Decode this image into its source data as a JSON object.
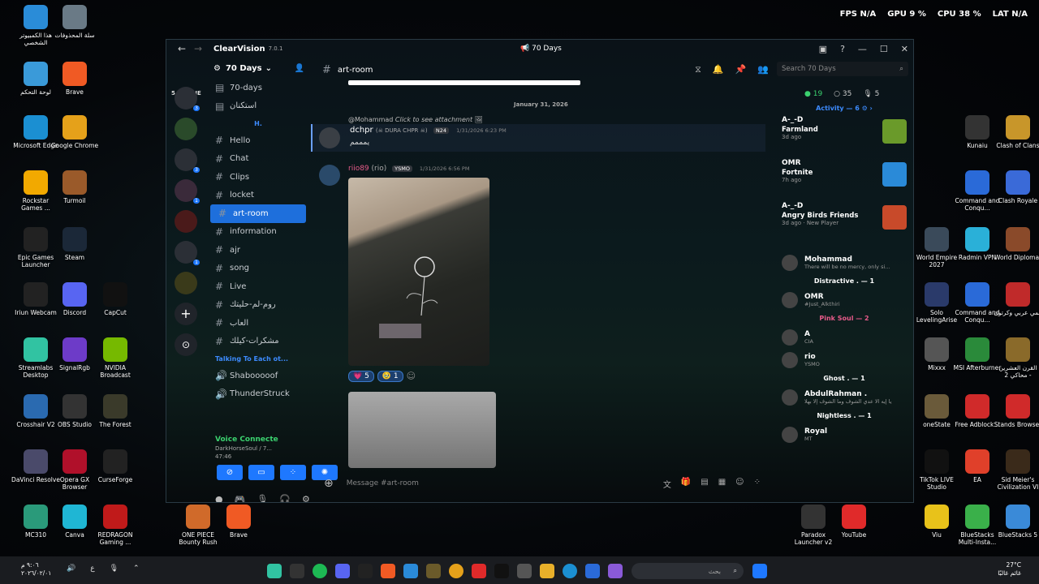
{
  "hud": {
    "fps_label": "FPS",
    "fps": "N/A",
    "gpu_label": "GPU",
    "gpu": "9 %",
    "cpu_label": "CPU",
    "cpu": "38 %",
    "lat_label": "LAT",
    "lat": "N/A"
  },
  "desktop_left": [
    {
      "label": "هذا الكمبيوتر الشخصي",
      "icon": "pc",
      "color": "#2a8cd8"
    },
    {
      "label": "سلة المحذوفات",
      "icon": "recycle",
      "color": "#6a7a86"
    },
    {
      "label": "لوحة التحكم",
      "icon": "panel",
      "color": "#3a9ad9"
    },
    {
      "label": "Brave",
      "icon": "brave",
      "color": "#f05a24"
    },
    {
      "label": "Microsoft Edge",
      "icon": "edge",
      "color": "#1b8fd2"
    },
    {
      "label": "Google Chrome",
      "icon": "chrome",
      "color": "#e5a11a"
    },
    {
      "label": "Rockstar Games ...",
      "icon": "rockstar",
      "color": "#f2a900"
    },
    {
      "label": "Turmoil",
      "icon": "turmoil",
      "color": "#9a5a2a"
    },
    {
      "label": "Epic Games Launcher",
      "icon": "epic",
      "color": "#222"
    },
    {
      "label": "Steam",
      "icon": "steam",
      "color": "#1b2838"
    },
    {
      "label": "Iriun Webcam",
      "icon": "iriun",
      "color": "#222"
    },
    {
      "label": "Discord",
      "icon": "discord",
      "color": "#5865f2"
    },
    {
      "label": "CapCut",
      "icon": "capcut",
      "color": "#111"
    },
    {
      "label": "Streamlabs Desktop",
      "icon": "streamlabs",
      "color": "#31c3a2"
    },
    {
      "label": "SignalRgb",
      "icon": "signalrgb",
      "color": "#6d3bc8"
    },
    {
      "label": "NVIDIA Broadcast",
      "icon": "nvidia",
      "color": "#76b900"
    },
    {
      "label": "Crosshair V2",
      "icon": "crosshair",
      "color": "#2a6ab0"
    },
    {
      "label": "OBS Studio",
      "icon": "obs",
      "color": "#333"
    },
    {
      "label": "The Forest",
      "icon": "forest",
      "color": "#3a3a2a"
    },
    {
      "label": "DaVinci Resolve",
      "icon": "davinci",
      "color": "#4a4a6a"
    },
    {
      "label": "Opera GX Browser",
      "icon": "opera",
      "color": "#b0102a"
    },
    {
      "label": "CurseForge",
      "icon": "curseforge",
      "color": "#222"
    },
    {
      "label": "MC310",
      "icon": "mc310",
      "color": "#2a9a7a"
    },
    {
      "label": "Canva",
      "icon": "canva",
      "color": "#1fb6d4"
    },
    {
      "label": "REDRAGON Gaming ...",
      "icon": "redragon",
      "color": "#c01a1a"
    },
    {
      "label": "ONE PIECE Bounty Rush",
      "icon": "onepiece",
      "color": "#d06a2a"
    },
    {
      "label": "Brave",
      "icon": "brave",
      "color": "#f05a24"
    }
  ],
  "desktop_right": [
    {
      "label": "Kunaiu",
      "icon": "kunai",
      "color": "#333"
    },
    {
      "label": "Clash of Clans",
      "icon": "coc",
      "color": "#c8962a"
    },
    {
      "label": "Command and Conqu...",
      "icon": "cnc",
      "color": "#2a6ad8"
    },
    {
      "label": "Clash Royale",
      "icon": "royale",
      "color": "#3a6ad8"
    },
    {
      "label": "World Empire 2027",
      "icon": "worldempire",
      "color": "#3a4a5a"
    },
    {
      "label": "Radmin VPN",
      "icon": "radmin",
      "color": "#2ab0d8"
    },
    {
      "label": "World Diplomat",
      "icon": "diplomat",
      "color": "#8a4a2a"
    },
    {
      "label": "Solo LevelingArise",
      "icon": "solo",
      "color": "#2a3a6a"
    },
    {
      "label": "Command and Conqu...",
      "icon": "cnc",
      "color": "#2a6ad8"
    },
    {
      "label": "انمي عربي وكرتون",
      "icon": "anime",
      "color": "#c02a2a"
    },
    {
      "label": "Mixxx",
      "icon": "mixxx",
      "color": "#555"
    },
    {
      "label": "MSI Afterburner",
      "icon": "msi",
      "color": "#2a8a3a"
    },
    {
      "label": "القرن العشرين محاكي 2 -",
      "icon": "century",
      "color": "#8a6a2a"
    },
    {
      "label": "oneState",
      "icon": "onestate",
      "color": "#6a5a3a"
    },
    {
      "label": "Free Adblock...",
      "icon": "adblock",
      "color": "#d02a2a"
    },
    {
      "label": "Stands Browser",
      "icon": "stands",
      "color": "#d02a2a"
    },
    {
      "label": "TikTok LIVE Studio",
      "icon": "tiktok",
      "color": "#111"
    },
    {
      "label": "EA",
      "icon": "ea",
      "color": "#e0402a"
    },
    {
      "label": "Sid Meier's Civilization VI",
      "icon": "civ",
      "color": "#3a2a1a"
    },
    {
      "label": "Paradox Launcher v2",
      "icon": "paradox",
      "color": "#333"
    },
    {
      "label": "YouTube",
      "icon": "youtube",
      "color": "#e02a2a"
    },
    {
      "label": "Viu",
      "icon": "viu",
      "color": "#e8c21a"
    },
    {
      "label": "BlueStacks Multi-Insta...",
      "icon": "bluestacks",
      "color": "#3ab04a"
    },
    {
      "label": "BlueStacks 5",
      "icon": "bluestacks5",
      "color": "#3a8ad8"
    }
  ],
  "window": {
    "app": "ClearVision",
    "version": "7.0.1",
    "title": "70 Days"
  },
  "guilds": {
    "online": "5 ONLINE",
    "badges": [
      "3",
      "3",
      "1",
      "1"
    ]
  },
  "channels": {
    "server": "70 Days",
    "items": [
      {
        "name": "70-days",
        "type": "text"
      },
      {
        "name": "استكنان",
        "type": "text"
      },
      {
        "cat": "H."
      },
      {
        "name": "Hello",
        "type": "hash"
      },
      {
        "name": "Chat",
        "type": "hash"
      },
      {
        "name": "Clips",
        "type": "hash"
      },
      {
        "name": "locket",
        "type": "hash"
      },
      {
        "name": "art-room",
        "type": "hash",
        "selected": true
      },
      {
        "name": "information",
        "type": "hash"
      },
      {
        "name": "ajr",
        "type": "hash"
      },
      {
        "name": "song",
        "type": "hash"
      },
      {
        "name": "Live",
        "type": "hash"
      },
      {
        "name": "روم-لم-حليتك",
        "type": "hash"
      },
      {
        "name": "العاب",
        "type": "hash"
      },
      {
        "name": "مشكرات-كيلك",
        "type": "hash"
      },
      {
        "cat": "Talking To Each ot..."
      },
      {
        "name": "Shabooooof",
        "type": "voice"
      },
      {
        "name": "ThunderStruck",
        "type": "voice"
      }
    ]
  },
  "voice": {
    "status": "Voice Connecte",
    "server": "DarkHorseSoul / 7...",
    "time": "47:46"
  },
  "header": {
    "channel": "art-room"
  },
  "search": {
    "placeholder": "Search 70 Days"
  },
  "messages": {
    "date": "January 31, 2026",
    "reply": {
      "user": "@Mohammad",
      "text": "Click to see attachment"
    },
    "m1": {
      "user": "dchpr",
      "deco": "(☠ DURA CHPR ☠)",
      "tag": "N24",
      "time": "1/31/2026 6:23 PM",
      "text": "يمممم"
    },
    "m2": {
      "user": "riio89",
      "nick": "(rio)",
      "tag": "YSMO",
      "time": "1/31/2026 6:56 PM"
    },
    "reactions": [
      {
        "emoji": "💗",
        "count": "5"
      },
      {
        "emoji": "🥹",
        "count": "1"
      }
    ]
  },
  "composer": {
    "placeholder": "Message #art-room"
  },
  "members": {
    "counts": [
      "19",
      "35",
      "5"
    ],
    "activity_header": "Activity — 6",
    "activities": [
      {
        "user": "A-_-D",
        "game": "Farmland",
        "sub": "3d ago",
        "color": "#6a9a2a"
      },
      {
        "user": "OMR",
        "game": "Fortnite",
        "sub": "7h ago",
        "color": "#2a8ad8"
      },
      {
        "user": "A-_-D",
        "game": "Angry Birds Friends",
        "sub": "3d ago · New Player",
        "color": "#c84a2a"
      }
    ],
    "groups": [
      {
        "header": "",
        "style": "",
        "members": [
          {
            "name": "Mohammad",
            "status": "There will be no mercy, only si..."
          }
        ]
      },
      {
        "header": "Distractive . — 1",
        "style": "w",
        "members": [
          {
            "name": "OMR",
            "status": "#Just_Alkthiri"
          }
        ]
      },
      {
        "header": "Pink Soul — 2",
        "style": "pink",
        "members": [
          {
            "name": "A",
            "status": "CIA"
          },
          {
            "name": "rio",
            "status": "YSMO"
          }
        ]
      },
      {
        "header": "Ghost . — 1",
        "style": "w",
        "members": [
          {
            "name": "AbdulRahman .",
            "status": "يا إيه الا عدي الشوف وما الشوف إلا بهلا"
          }
        ]
      },
      {
        "header": "Nightless . — 1",
        "style": "w",
        "members": [
          {
            "name": "Royal",
            "status": "MT"
          }
        ]
      }
    ]
  },
  "taskbar": {
    "search": "بحث",
    "time": "٩:٠٦ م",
    "date": "٢٠٢٦/٠٢/٠١",
    "lang": "ع",
    "temp": "27°C",
    "weather": "غائم غالبًا"
  }
}
